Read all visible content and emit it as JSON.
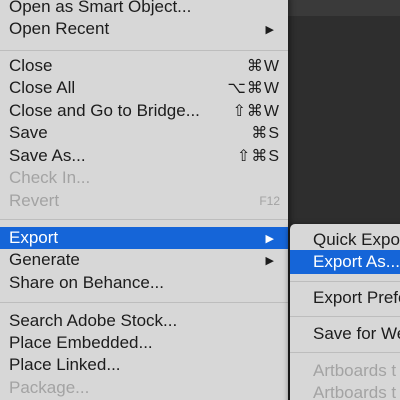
{
  "file_menu": {
    "items": [
      {
        "label": "Open as Smart Object...",
        "shortcut": ""
      },
      {
        "label": "Open Recent",
        "submenu_arrow": "▶"
      },
      {
        "label": "Close",
        "shortcut": "⌘W"
      },
      {
        "label": "Close All",
        "shortcut": "⌥⌘W"
      },
      {
        "label": "Close and Go to Bridge...",
        "shortcut": "⇧⌘W"
      },
      {
        "label": "Save",
        "shortcut": "⌘S"
      },
      {
        "label": "Save As...",
        "shortcut": "⇧⌘S"
      },
      {
        "label": "Check In...",
        "disabled": true
      },
      {
        "label": "Revert",
        "shortcut": "F12",
        "disabled": true
      },
      {
        "label": "Export",
        "submenu_arrow": "▶",
        "highlighted": true
      },
      {
        "label": "Generate",
        "submenu_arrow": "▶"
      },
      {
        "label": "Share on Behance..."
      },
      {
        "label": "Search Adobe Stock..."
      },
      {
        "label": "Place Embedded..."
      },
      {
        "label": "Place Linked..."
      },
      {
        "label": "Package...",
        "disabled": true
      }
    ]
  },
  "export_submenu": {
    "items": [
      {
        "label": "Quick Expo"
      },
      {
        "label": "Export As...",
        "highlighted": true
      },
      {
        "label": "Export Prefe"
      },
      {
        "label": "Save for We"
      },
      {
        "label": "Artboards t",
        "disabled": true
      },
      {
        "label": "Artboards t",
        "disabled": true
      }
    ]
  },
  "colors": {
    "menu_bg": "#d7d7d7",
    "highlight": "#1565d8",
    "disabled_text": "#a3a3a3",
    "app_bg": "#2b2b2b"
  }
}
